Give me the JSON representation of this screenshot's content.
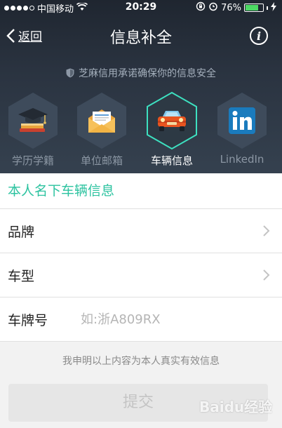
{
  "status_bar": {
    "carrier": "中国移动",
    "time": "20:29",
    "battery_percent": "76%",
    "battery_level": 0.76,
    "signal_bars": 4
  },
  "nav": {
    "back_label": "返回",
    "title": "信息补全",
    "info_glyph": "i"
  },
  "security_note": "芝麻信用承诺确保你的信息安全",
  "categories": [
    {
      "label": "学历学籍",
      "icon": "graduation-cap-icon",
      "active": false
    },
    {
      "label": "单位邮箱",
      "icon": "envelope-icon",
      "active": false
    },
    {
      "label": "车辆信息",
      "icon": "car-icon",
      "active": true
    },
    {
      "label": "LinkedIn",
      "icon": "linkedin-icon",
      "active": false
    }
  ],
  "form": {
    "section_title": "本人名下车辆信息",
    "brand_label": "品牌",
    "model_label": "车型",
    "plate_label": "车牌号",
    "plate_placeholder": "如:浙A809RX"
  },
  "declaration": "我申明以上内容为本人真实有效信息",
  "submit_label": "提交",
  "watermark": "Baidu经验",
  "colors": {
    "accent": "#2dc3a0",
    "header_bg": "#2a3340",
    "active_glow": "#3de0c0",
    "battery_fill": "#4cd964"
  }
}
